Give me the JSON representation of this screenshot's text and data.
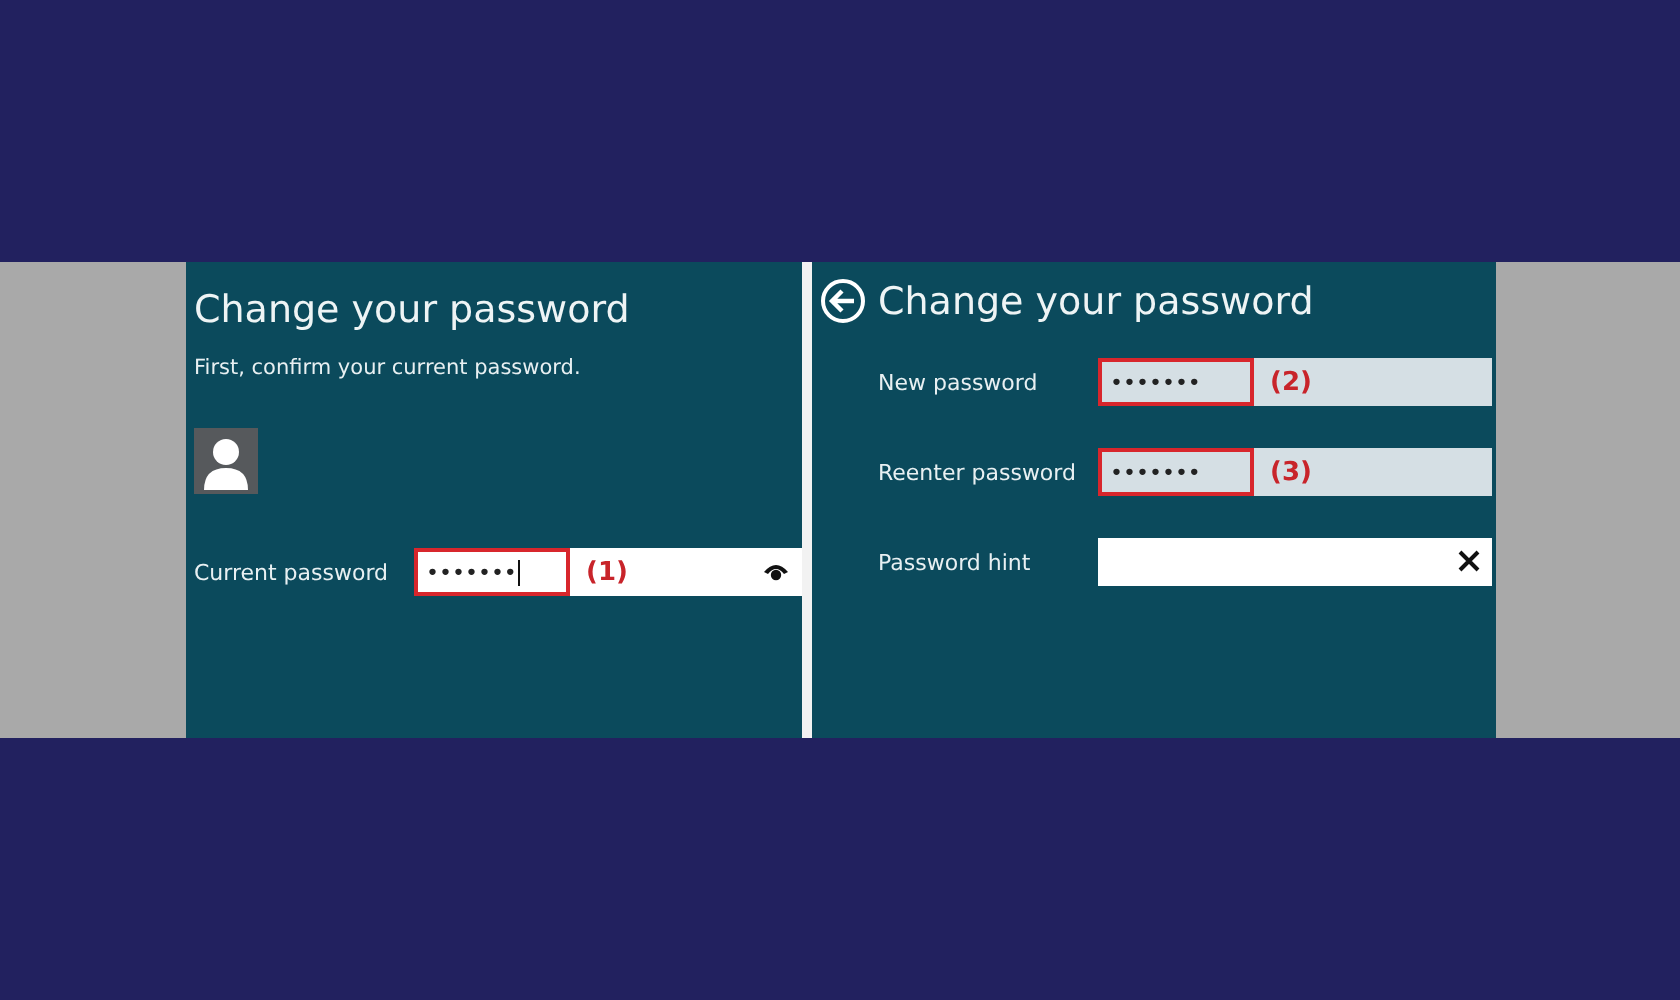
{
  "left_panel": {
    "title": "Change your password",
    "subtitle": "First, confirm your current password.",
    "fields": [
      {
        "kind": "password",
        "label": "Current password",
        "value": "•••••••",
        "annotation": "(1)",
        "focused": true
      }
    ]
  },
  "right_panel": {
    "title": "Change your password",
    "fields": [
      {
        "kind": "password",
        "label": "New password",
        "value": "•••••••",
        "annotation": "(2)",
        "focused": false
      },
      {
        "kind": "password",
        "label": "Reenter password",
        "value": "•••••••",
        "annotation": "(3)",
        "focused": false
      },
      {
        "kind": "text",
        "label": "Password hint"
      }
    ]
  }
}
